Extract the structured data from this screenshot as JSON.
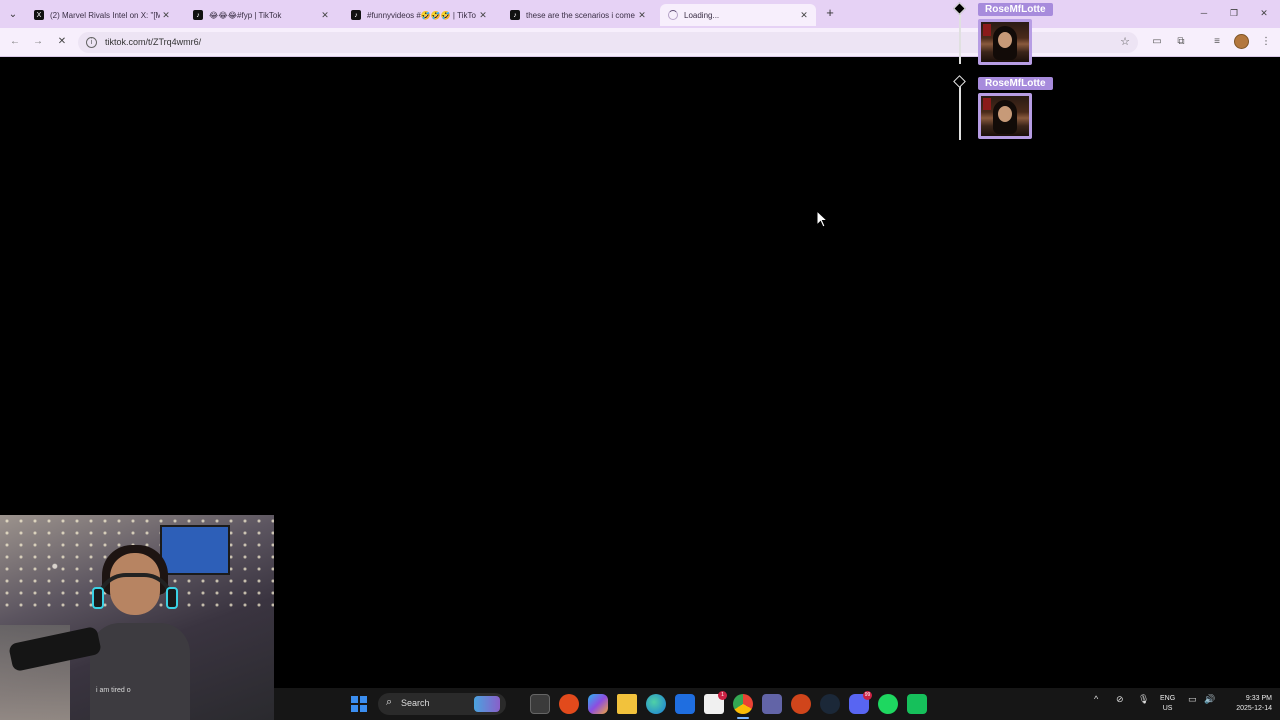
{
  "browser": {
    "tabs": [
      {
        "title": "(2) Marvel Rivals Intel on X: \"[M",
        "favicon": "x-icon",
        "active": false
      },
      {
        "title": "😂😂😂#fyp | TikTok",
        "favicon": "tiktok-icon",
        "active": false
      },
      {
        "title": "#funnyvideos #🤣🤣🤣 | TikTo",
        "favicon": "tiktok-icon",
        "active": false
      },
      {
        "title": "these are the scenarios i come u",
        "favicon": "tiktok-icon",
        "active": false
      },
      {
        "title": "Loading...",
        "favicon": "spinner-icon",
        "active": true
      }
    ],
    "close_glyph": "✕",
    "new_tab_glyph": "+",
    "url": "tiktok.com/t/ZTrq4wmr6/"
  },
  "overlay": {
    "messages": [
      {
        "username": "RoseMfLotte"
      },
      {
        "username": "RoseMfLotte"
      }
    ]
  },
  "webcam": {
    "shirt_text": "i am tired o"
  },
  "taskbar": {
    "search_label": "Search",
    "teams_badge": "1",
    "discord_badge": "99",
    "lang_line1": "ENG",
    "lang_line2": "US",
    "time": "9:33 PM",
    "date": "2025-12-14"
  },
  "colors": {
    "tab_strip": "#e6d2f5",
    "toolbar": "#f7effc",
    "overlay_accent": "#a78bdc",
    "taskbar": "#161616",
    "page": "#000000"
  }
}
